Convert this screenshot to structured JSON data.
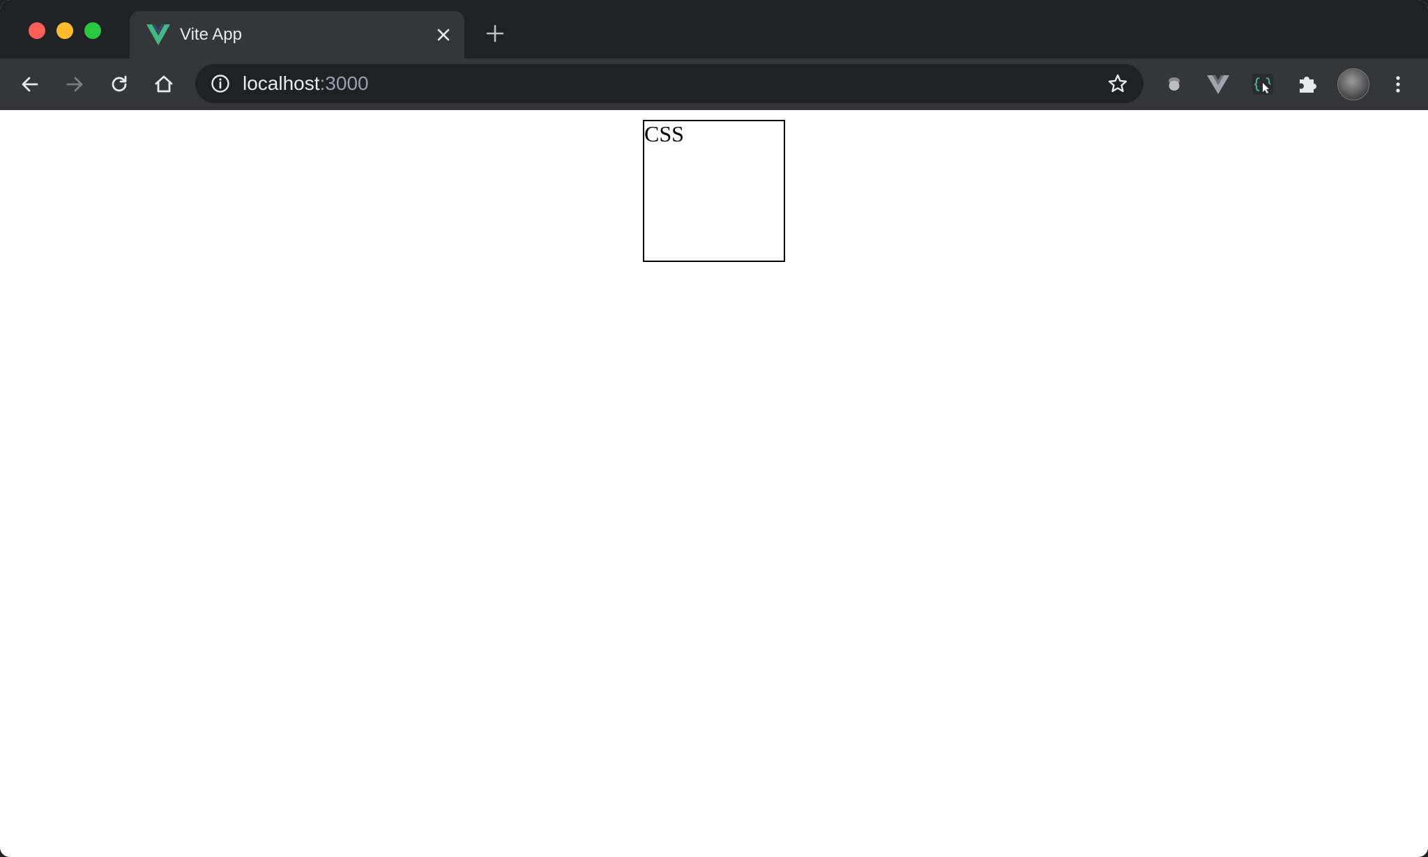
{
  "browser": {
    "tab": {
      "title": "Vite App",
      "favicon": "vue-logo-icon"
    },
    "address": {
      "host": "localhost",
      "port": ":3000"
    },
    "colors": {
      "frame": "#202124",
      "toolbar": "#35363a",
      "vue_green": "#42b883",
      "vue_dark": "#35495e"
    }
  },
  "page": {
    "box_text": "CSS"
  }
}
